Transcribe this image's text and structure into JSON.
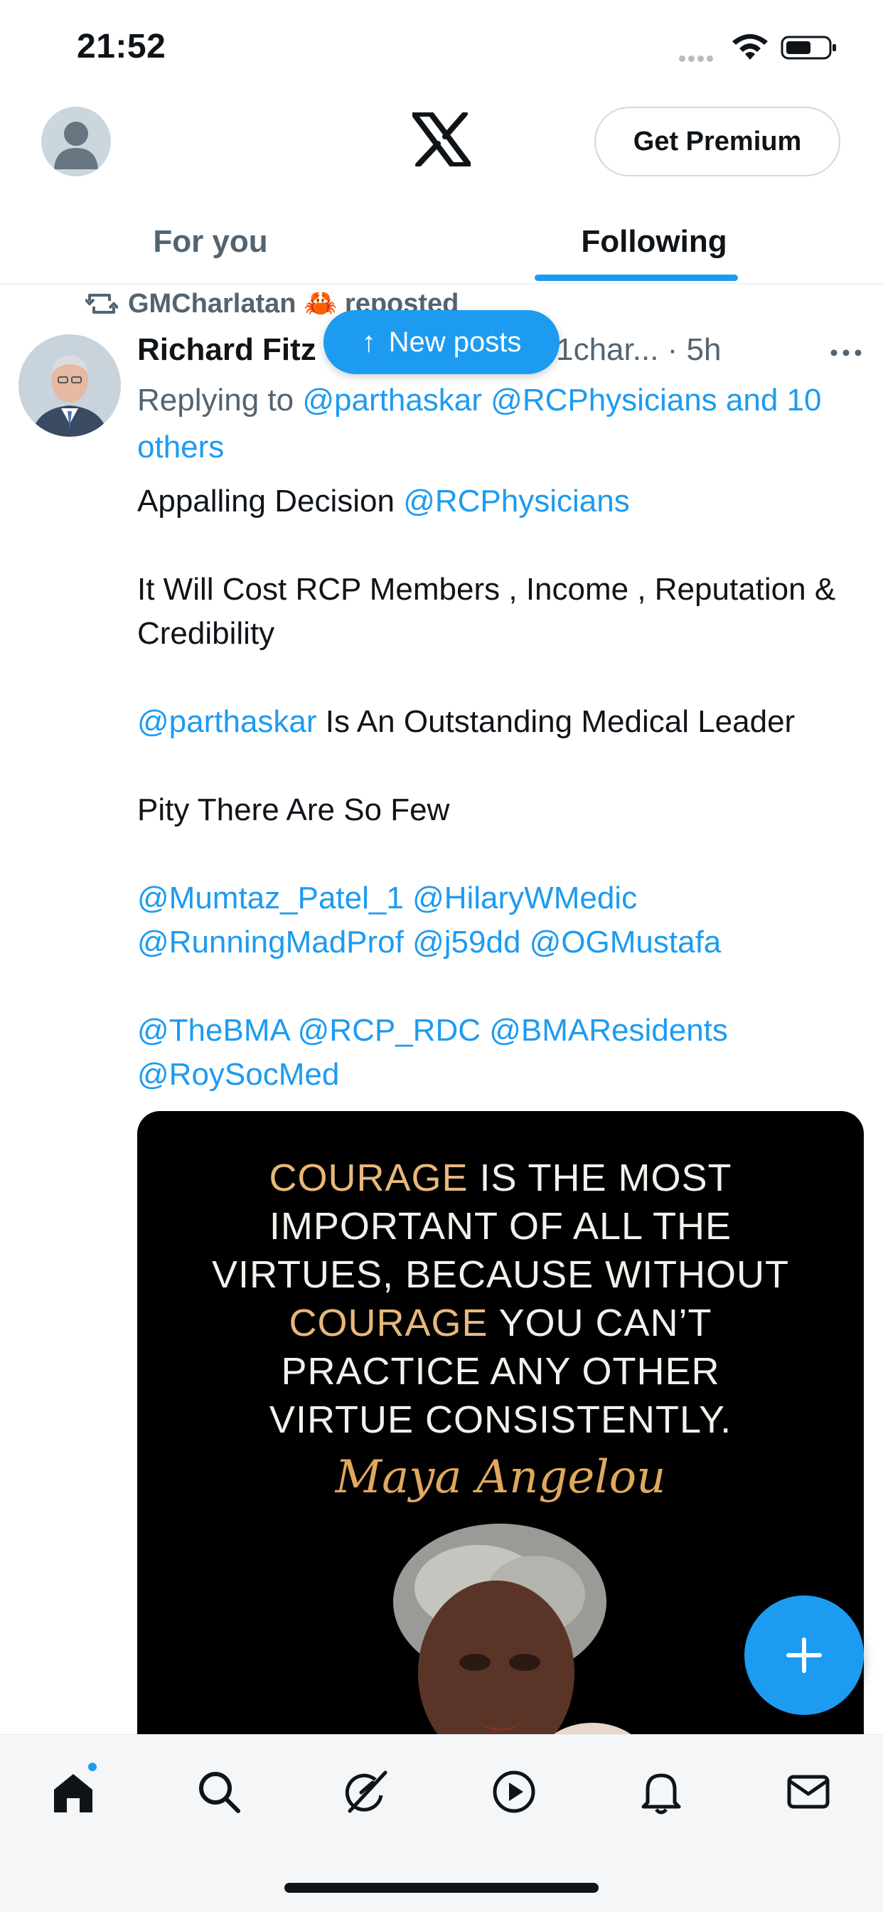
{
  "status_bar": {
    "time": "21:52"
  },
  "header": {
    "premium_label": "Get Premium",
    "tabs": [
      {
        "label": "For you",
        "active": false
      },
      {
        "label": "Following",
        "active": true
      }
    ]
  },
  "post": {
    "repost_by": "GMCharlatan 🦀 reposted",
    "author_name": "Richard Fitz",
    "author_handle": "@r1char... · 5h",
    "reply_prefix": "Replying to",
    "reply_to": "@parthaskar @RCPhysicians and 10 others",
    "text": {
      "line1_plain": "Appalling Decision ",
      "line1_mention": "@RCPhysicians",
      "line2": "It Will Cost RCP Members , Income , Reputation & Credibility",
      "line3_mention": "@parthaskar",
      "line3_plain": " Is An Outstanding Medical Leader",
      "line4": "Pity There Are So Few",
      "mentions_1": "@Mumtaz_Patel_1 @HilaryWMedic @RunningMadProf @j59dd @OGMustafa",
      "mentions_2": "@TheBMA @RCP_RDC @BMAResidents @RoySocMed"
    },
    "media": {
      "quote_l1_gold": "COURAGE",
      "quote_l1_rest": " IS THE MOST",
      "quote_l2": "IMPORTANT OF ALL THE",
      "quote_l3": "VIRTUES, BECAUSE WITHOUT",
      "quote_l4_gold": "COURAGE",
      "quote_l4_rest": " YOU CAN’T",
      "quote_l5": "PRACTICE ANY OTHER",
      "quote_l6": "VIRTUE CONSISTENTLY.",
      "signature": "Maya Angelou"
    }
  },
  "new_posts_pill": {
    "label": "New posts"
  },
  "bottom_nav": {
    "items": [
      "home-icon",
      "search-icon",
      "grok-icon",
      "video-icon",
      "notifications-icon",
      "messages-icon"
    ]
  },
  "colors": {
    "accent": "#1d9bf0",
    "text_primary": "#0f1419",
    "text_secondary": "#536471",
    "quote_gold": "#e8b87a"
  }
}
